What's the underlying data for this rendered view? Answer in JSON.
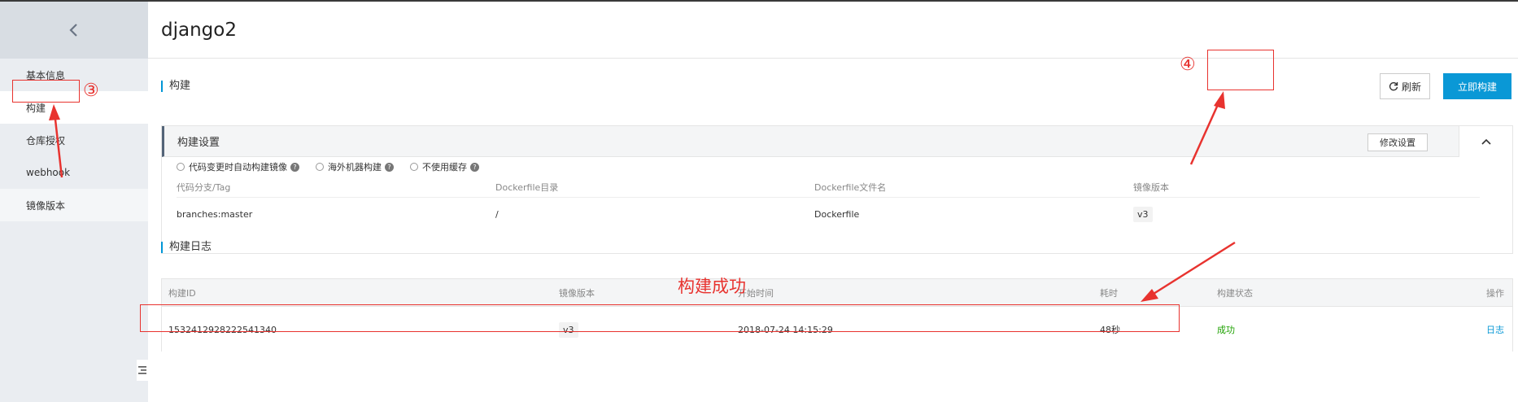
{
  "sidebar": {
    "back_icon": "chevron-left-icon",
    "items": [
      {
        "label": "基本信息"
      },
      {
        "label": "构建"
      },
      {
        "label": "仓库授权"
      },
      {
        "label": "webhook"
      },
      {
        "label": "镜像版本"
      }
    ],
    "toggle_icon": "menu-icon"
  },
  "page": {
    "title": "django2"
  },
  "build_section": {
    "title": "构建",
    "refresh_label": "刷新",
    "build_now_label": "立即构建"
  },
  "settings_panel": {
    "title": "构建设置",
    "modify_label": "修改设置",
    "options": [
      {
        "label": "代码变更时自动构建镜像"
      },
      {
        "label": "海外机器构建"
      },
      {
        "label": "不使用缓存"
      }
    ],
    "columns": [
      "代码分支/Tag",
      "Dockerfile目录",
      "Dockerfile文件名",
      "镜像版本"
    ],
    "row": {
      "branch": "branches:master",
      "dir": "/",
      "file": "Dockerfile",
      "version": "v3"
    }
  },
  "log_section": {
    "title": "构建日志",
    "columns": [
      "构建ID",
      "镜像版本",
      "开始时间",
      "耗时",
      "构建状态",
      "操作"
    ],
    "rows": [
      {
        "id": "1532412928222541340",
        "version": "v3",
        "start": "2018-07-24 14:15:29",
        "duration": "48秒",
        "status": "成功",
        "action": "日志"
      }
    ]
  },
  "annotations": {
    "step3": "③",
    "step4": "④",
    "success_note": "构建成功",
    "color": "#e8332f"
  },
  "colors": {
    "accent": "#0a98d6",
    "success": "#1ea100",
    "sidebar_bg": "#eaedf1"
  }
}
